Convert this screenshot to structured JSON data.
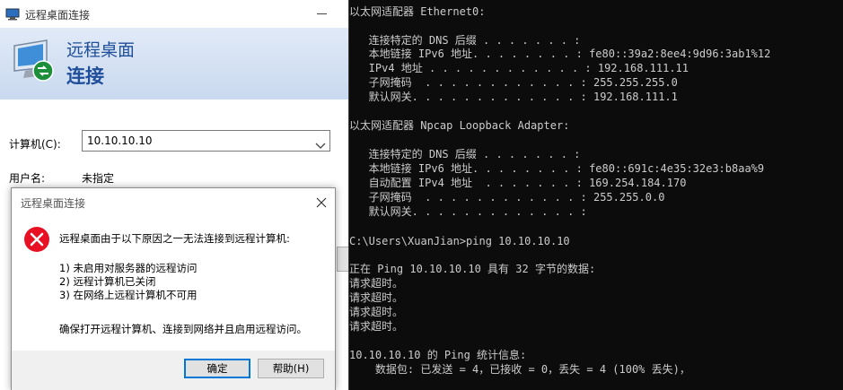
{
  "rdp": {
    "window_title": "远程桌面连接",
    "banner_line1": "远程桌面",
    "banner_line2": "连接",
    "computer_label": "计算机(C):",
    "computer_value": "10.10.10.10",
    "user_label": "用户名:",
    "user_value": "未指定"
  },
  "dialog": {
    "title": "远程桌面连接",
    "message": "远程桌面由于以下原因之一无法连接到远程计算机:",
    "reasons": [
      "1) 未启用对服务器的远程访问",
      "2) 远程计算机已关闭",
      "3) 在网络上远程计算机不可用"
    ],
    "tip": "确保打开远程计算机、连接到网络并且启用远程访问。",
    "ok_label": "确定",
    "help_label": "帮助(H)"
  },
  "console": {
    "lines": [
      "以太网适配器 Ethernet0:",
      "",
      "   连接特定的 DNS 后缀 . . . . . . . :",
      "   本地链接 IPv6 地址. . . . . . . . : fe80::39a2:8ee4:9d96:3ab1%12",
      "   IPv4 地址 . . . . . . . . . . . . : 192.168.111.11",
      "   子网掩码  . . . . . . . . . . . . : 255.255.255.0",
      "   默认网关. . . . . . . . . . . . . : 192.168.111.1",
      "",
      "以太网适配器 Npcap Loopback Adapter:",
      "",
      "   连接特定的 DNS 后缀 . . . . . . . :",
      "   本地链接 IPv6 地址. . . . . . . . : fe80::691c:4e35:32e3:b8aa%9",
      "   自动配置 IPv4 地址  . . . . . . . : 169.254.184.170",
      "   子网掩码  . . . . . . . . . . . . : 255.255.0.0",
      "   默认网关. . . . . . . . . . . . . :",
      "",
      "C:\\Users\\XuanJian>ping 10.10.10.10",
      "",
      "正在 Ping 10.10.10.10 具有 32 字节的数据:",
      "请求超时。",
      "请求超时。",
      "请求超时。",
      "请求超时。",
      "",
      "10.10.10.10 的 Ping 统计信息:",
      "    数据包: 已发送 = 4，已接收 = 0，丢失 = 4 (100% 丢失)，"
    ]
  }
}
